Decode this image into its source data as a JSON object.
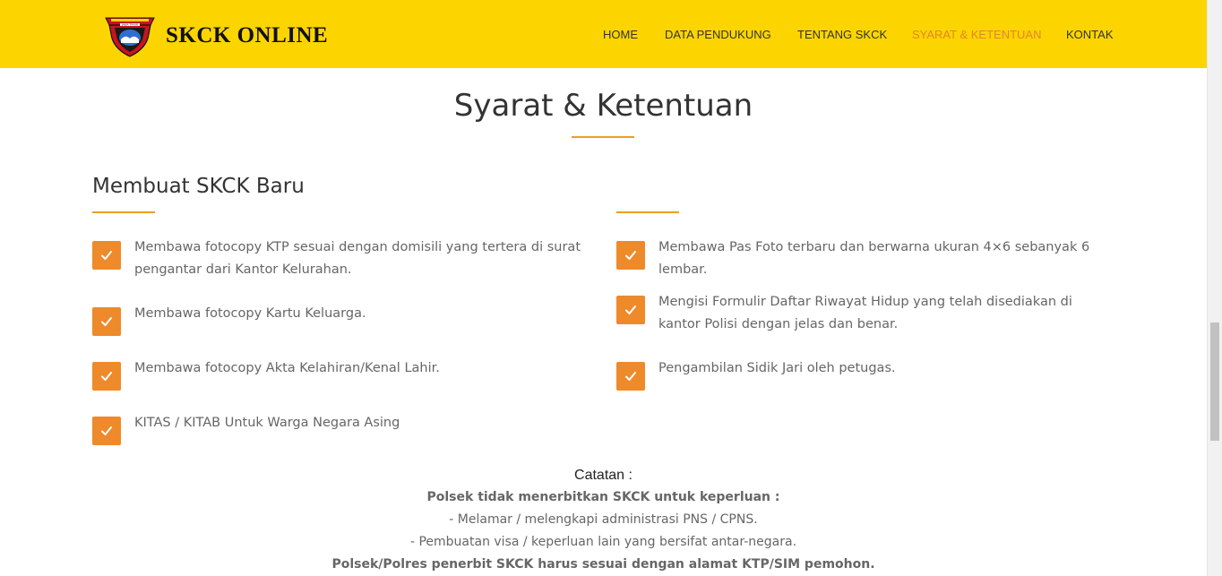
{
  "header": {
    "brand": "SKCK ONLINE",
    "logo_text": "JAWA TIMUR",
    "nav": [
      {
        "label": "HOME"
      },
      {
        "label": "DATA PENDUKUNG"
      },
      {
        "label": "TENTANG SKCK"
      },
      {
        "label": "SYARAT & KETENTUAN",
        "active": true
      },
      {
        "label": "KONTAK"
      }
    ],
    "colors": {
      "background": "#fcd500",
      "active": "#e8822c"
    }
  },
  "main": {
    "title": "Syarat & Ketentuan",
    "section_heading": "Membuat SKCK Baru",
    "left_items": [
      {
        "text": "Membawa fotocopy KTP sesuai dengan domisili yang tertera di surat pengantar dari Kantor Kelurahan."
      },
      {
        "text": "Membawa fotocopy Kartu Keluarga."
      },
      {
        "text": "Membawa fotocopy Akta Kelahiran/Kenal Lahir."
      },
      {
        "text": "KITAS / KITAB Untuk Warga Negara Asing"
      }
    ],
    "right_items": [
      {
        "text": "Membawa Pas Foto terbaru dan berwarna ukuran 4×6 sebanyak 6 lembar."
      },
      {
        "text": "Mengisi Formulir Daftar Riwayat Hidup yang telah disediakan di kantor Polisi dengan jelas dan benar."
      },
      {
        "text": "Pengambilan Sidik Jari oleh petugas."
      }
    ],
    "check_icon": "check-icon",
    "accent_color": "#ee8a2a"
  },
  "notes": {
    "title": "Catatan :",
    "line1": "Polsek tidak menerbitkan SKCK untuk keperluan :",
    "line2": "- Melamar / melengkapi administrasi PNS / CPNS.",
    "line3": "- Pembuatan visa / keperluan lain yang bersifat antar-negara.",
    "line4": "Polsek/Polres penerbit SKCK harus sesuai dengan alamat KTP/SIM pemohon."
  }
}
